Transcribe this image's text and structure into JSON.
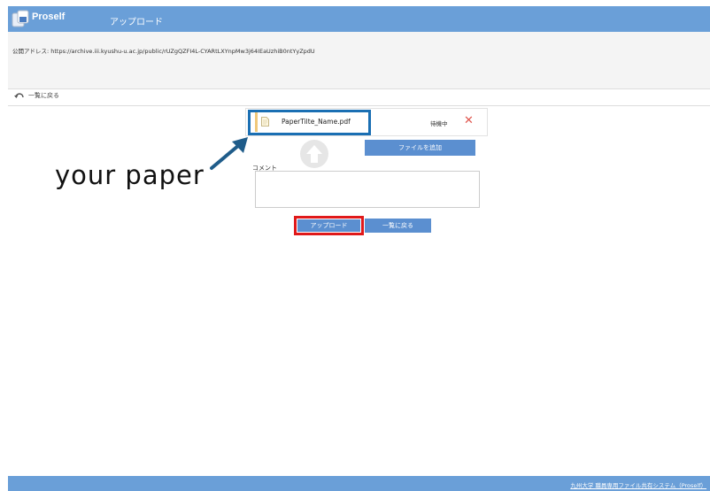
{
  "header": {
    "app_name": "Proself",
    "page_title": "アップロード"
  },
  "address": {
    "text": "公開アドレス: https://archive.iii.kyushu-u.ac.jp/public/rUZgQZFI4L-CYARtLXYnpMw3j64IEaUzhiB0ntYyZpdU"
  },
  "nav": {
    "back_label": "一覧に戻る"
  },
  "file": {
    "name": "PaperTilte_Name.pdf",
    "status": "待機中",
    "remove": "✕"
  },
  "buttons": {
    "add_file": "ファイルを追加",
    "upload": "アップロード",
    "back": "一覧に戻る"
  },
  "comment": {
    "label": "コメント",
    "value": ""
  },
  "annotation": {
    "text": "your paper"
  },
  "footer": {
    "link": "九州大学 職員専用ファイル共有システム（Proself）"
  },
  "colors": {
    "brand": "#6a9fd8",
    "button": "#5b8fd0",
    "highlight_blue": "#1a6fb3",
    "highlight_red": "#e0191a",
    "remove": "#e0574f"
  }
}
